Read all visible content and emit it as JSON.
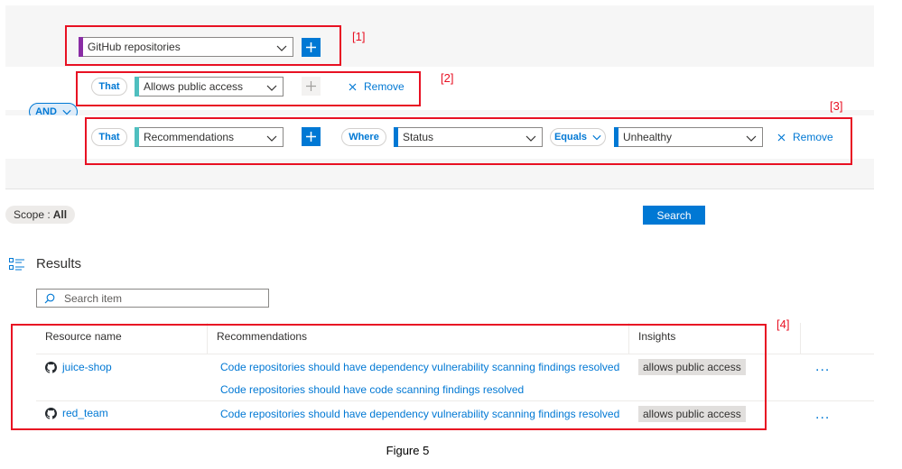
{
  "builder": {
    "row1": {
      "select": "GitHub repositories",
      "annotation": "[1]"
    },
    "row2": {
      "that": "That",
      "select": "Allows public access",
      "remove": "Remove",
      "annotation": "[2]"
    },
    "and_label": "AND",
    "row3": {
      "that": "That",
      "select": "Recommendations",
      "where": "Where",
      "field": "Status",
      "operator": "Equals",
      "value": "Unhealthy",
      "remove": "Remove",
      "annotation": "[3]"
    }
  },
  "scope": {
    "label": "Scope :",
    "value": "All"
  },
  "search_button": "Search",
  "results": {
    "title": "Results",
    "search_placeholder": "Search item",
    "annotation": "[4]",
    "columns": [
      "Resource name",
      "Recommendations",
      "Insights"
    ],
    "rows": [
      {
        "name": "juice-shop",
        "recommendations": [
          "Code repositories should have dependency vulnerability scanning findings resolved",
          "Code repositories should have code scanning findings resolved"
        ],
        "insight": "allows public access",
        "more": "..."
      },
      {
        "name": "red_team",
        "recommendations": [
          "Code repositories should have dependency vulnerability scanning findings resolved"
        ],
        "insight": "allows public access",
        "more": "..."
      }
    ]
  },
  "caption": "Figure 5",
  "colors": {
    "accent": "#0078d4",
    "annotation": "#e81123",
    "resource_bar": "#8a2da5",
    "condition_bar": "#4fbfbf"
  },
  "icons": {
    "results": "list-icon",
    "search": "search-icon",
    "repo": "github-icon",
    "remove": "close-icon"
  }
}
